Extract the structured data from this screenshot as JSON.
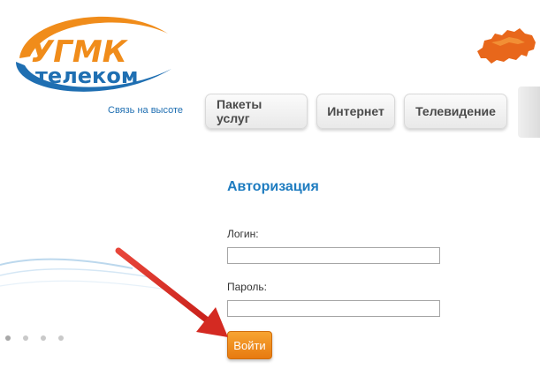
{
  "brand": {
    "logo_line1": "УГМК",
    "logo_line2": "телеком",
    "tagline": "Связь на высоте",
    "colors": {
      "orange": "#f08c1a",
      "blue": "#1f6fb2"
    }
  },
  "nav": {
    "items": [
      {
        "label": "Пакеты услуг"
      },
      {
        "label": "Интернет"
      },
      {
        "label": "Телевидение"
      }
    ]
  },
  "auth": {
    "title": "Авторизация",
    "login_label": "Логин:",
    "login_value": "",
    "password_label": "Пароль:",
    "password_value": "",
    "submit_label": "Войти"
  },
  "icons": {
    "map": "russia-map-icon",
    "annotation": "red-arrow-icon"
  },
  "theme": {
    "accent": "#1e7cc0",
    "button_orange": "#ef8a1e",
    "arrow_red": "#e0312a"
  }
}
